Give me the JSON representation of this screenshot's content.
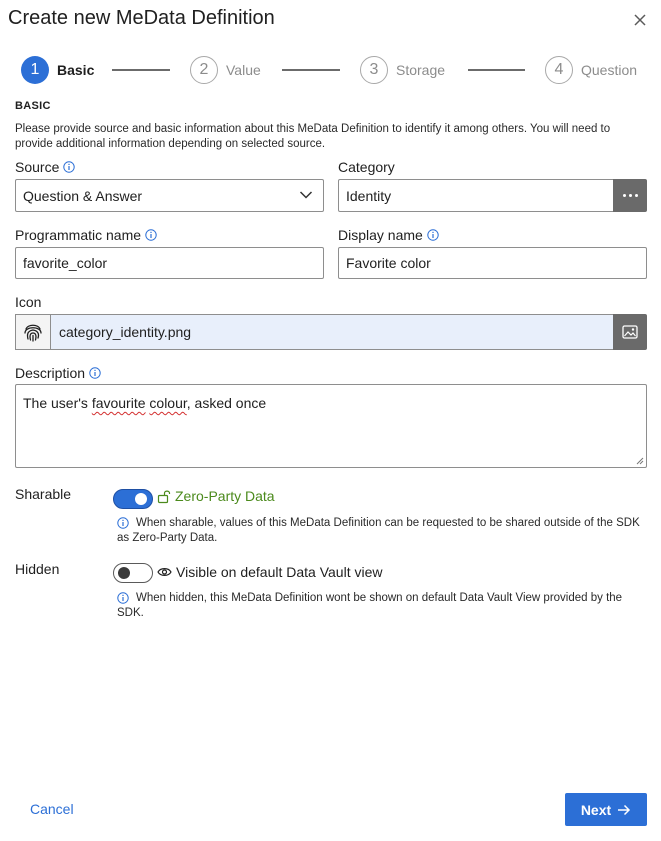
{
  "dialog": {
    "title": "Create new MeData Definition"
  },
  "stepper": {
    "steps": [
      {
        "number": "1",
        "label": "Basic",
        "active": true
      },
      {
        "number": "2",
        "label": "Value",
        "active": false
      },
      {
        "number": "3",
        "label": "Storage",
        "active": false
      },
      {
        "number": "4",
        "label": "Question",
        "active": false
      }
    ]
  },
  "section": {
    "heading": "BASIC",
    "description": "Please provide source and basic information about this MeData Definition to identify it among others. You will need to provide additional information depending on selected source."
  },
  "fields": {
    "source": {
      "label": "Source",
      "value": "Question & Answer"
    },
    "category": {
      "label": "Category",
      "value": "Identity"
    },
    "programmatic_name": {
      "label": "Programmatic name",
      "value": "favorite_color"
    },
    "display_name": {
      "label": "Display name",
      "value": "Favorite color"
    },
    "icon": {
      "label": "Icon",
      "value": "category_identity.png"
    },
    "description": {
      "label": "Description",
      "value_parts": [
        "The user's ",
        "favourite",
        " ",
        "colour",
        ", asked once"
      ]
    }
  },
  "sharable": {
    "label": "Sharable",
    "state": "on",
    "status_text": "Zero-Party Data",
    "hint": "When sharable, values of this MeData Definition can be requested to be shared outside of the SDK as Zero-Party Data."
  },
  "hidden": {
    "label": "Hidden",
    "state": "off",
    "status_text": "Visible on default Data Vault view",
    "hint": "When hidden, this MeData Definition wont be shown on default Data Vault View provided by the SDK."
  },
  "footer": {
    "cancel_label": "Cancel",
    "next_label": "Next"
  },
  "colors": {
    "primary": "#2c6fd6",
    "success": "#4b8a1c",
    "icon_input_bg": "#e8effb",
    "addon_button_bg": "#6a6a6a"
  },
  "icons": [
    "close-icon",
    "info-icon",
    "chevron-down-icon",
    "more-dots-icon",
    "fingerprint-icon",
    "image-icon",
    "unlock-icon",
    "eye-icon",
    "arrow-right-icon"
  ]
}
